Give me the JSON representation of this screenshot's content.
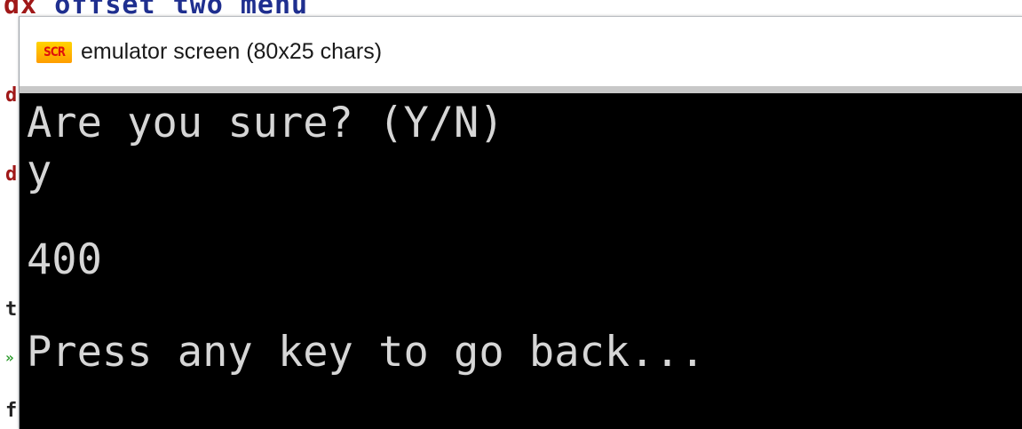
{
  "background_editor": {
    "top_line_part1": "dx",
    "top_line_part2": "offset",
    "top_line_part3": "two menu",
    "gutter_chars": [
      {
        "char": "d",
        "color": "#a01818"
      },
      {
        "char": "d",
        "color": "#a01818"
      },
      {
        "char": "t",
        "color": "#222222"
      },
      {
        "char": "»",
        "color": "#2a9a2a"
      },
      {
        "char": "f",
        "color": "#222222"
      }
    ]
  },
  "window": {
    "icon_label": "SCR",
    "title": "emulator screen (80x25 chars)"
  },
  "terminal": {
    "lines": [
      "Are you sure? (Y/N)",
      "y",
      "",
      "400",
      "",
      "Press any key to go back..."
    ],
    "text_color": "#d6d6d6",
    "background_color": "#000000"
  }
}
